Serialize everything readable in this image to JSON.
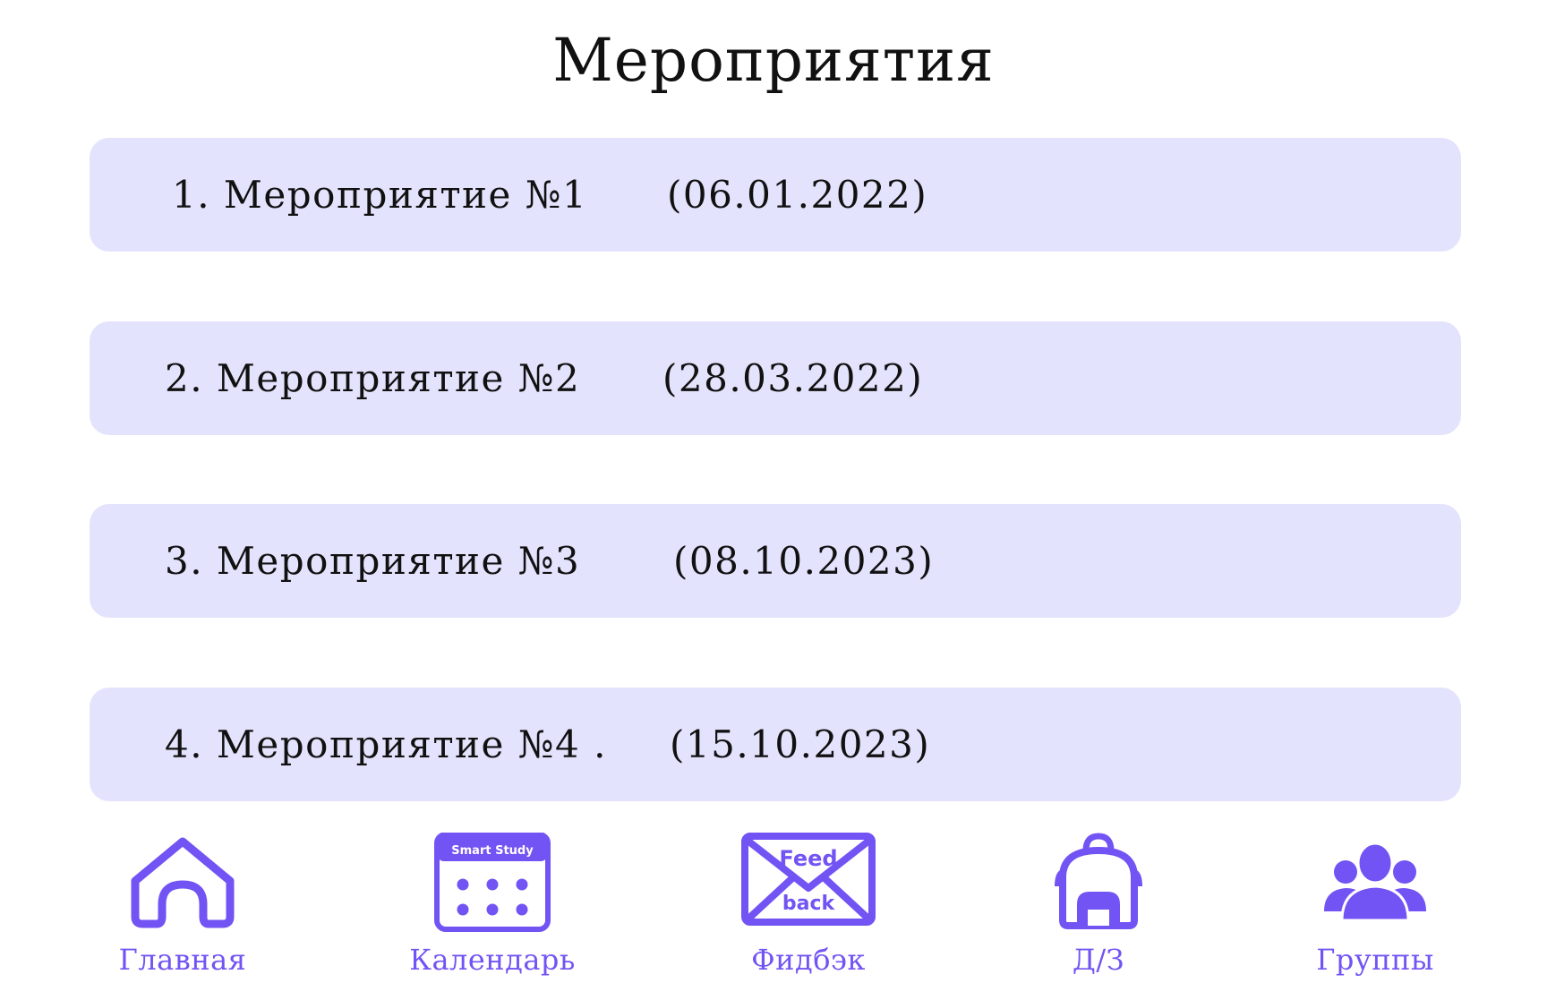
{
  "page": {
    "title": "Мероприятия"
  },
  "events": [
    {
      "name": "1. Мероприятие №1",
      "date": "(06.01.2022)"
    },
    {
      "name": "2. Мероприятие №2",
      "date": "(28.03.2022)"
    },
    {
      "name": "3. Мероприятие №3",
      "date": "(08.10.2023)"
    },
    {
      "name": "4. Мероприятие №4 .",
      "date": "(15.10.2023)"
    }
  ],
  "nav": {
    "home": {
      "label": "Главная",
      "icon": "home-icon"
    },
    "calendar": {
      "label": "Календарь",
      "icon": "calendar-icon",
      "icon_text": "Smart Study"
    },
    "feedback": {
      "label": "Фидбэк",
      "icon": "envelope-icon",
      "icon_text_top": "Feed",
      "icon_text_bottom": "back"
    },
    "homework": {
      "label": "Д/З",
      "icon": "backpack-icon"
    },
    "groups": {
      "label": "Группы",
      "icon": "users-icon"
    }
  },
  "colors": {
    "accent": "#7253f3",
    "card_background": "#e4e3fd",
    "text": "#111111"
  }
}
